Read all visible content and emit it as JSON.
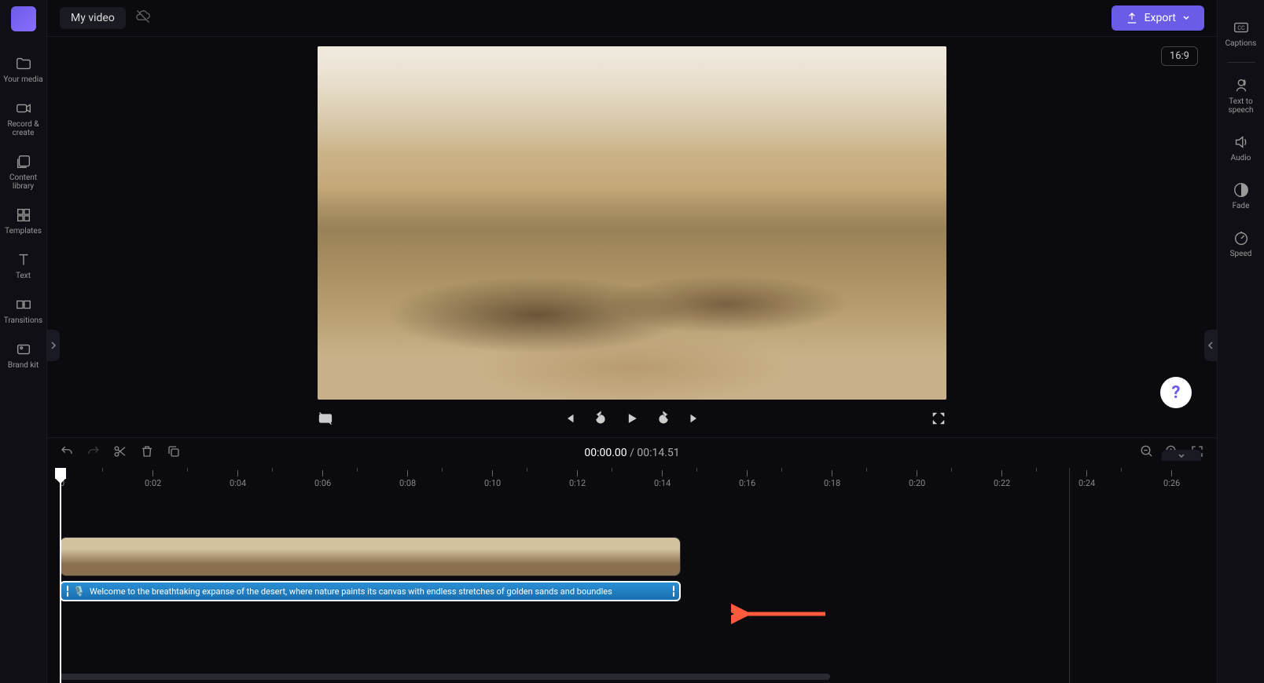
{
  "header": {
    "project_title": "My video",
    "export_label": "Export",
    "aspect_ratio": "16:9"
  },
  "left_sidebar": {
    "items": [
      {
        "label": "Your media",
        "icon": "folder-icon"
      },
      {
        "label": "Record & create",
        "icon": "camera-icon"
      },
      {
        "label": "Content library",
        "icon": "library-icon"
      },
      {
        "label": "Templates",
        "icon": "templates-icon"
      },
      {
        "label": "Text",
        "icon": "text-icon"
      },
      {
        "label": "Transitions",
        "icon": "transitions-icon"
      },
      {
        "label": "Brand kit",
        "icon": "brand-icon"
      }
    ]
  },
  "right_sidebar": {
    "items": [
      {
        "label": "Captions",
        "icon": "captions-icon"
      },
      {
        "label": "Text to speech",
        "icon": "tts-icon"
      },
      {
        "label": "Audio",
        "icon": "audio-icon"
      },
      {
        "label": "Fade",
        "icon": "fade-icon"
      },
      {
        "label": "Speed",
        "icon": "speed-icon"
      }
    ]
  },
  "playback": {
    "current_time": "00:00.00",
    "divider": "/",
    "total_time": "00:14.51"
  },
  "ruler": {
    "ticks": [
      "0",
      "0:02",
      "0:04",
      "0:06",
      "0:08",
      "0:10",
      "0:12",
      "0:14",
      "0:16",
      "0:18",
      "0:20",
      "0:22",
      "0:24",
      "0:26"
    ]
  },
  "timeline": {
    "audio_clip_text": "Welcome to the breathtaking expanse of the desert, where nature paints its canvas with endless stretches of golden sands and boundles",
    "audio_icon": "🎙️"
  },
  "help": {
    "label": "?"
  }
}
